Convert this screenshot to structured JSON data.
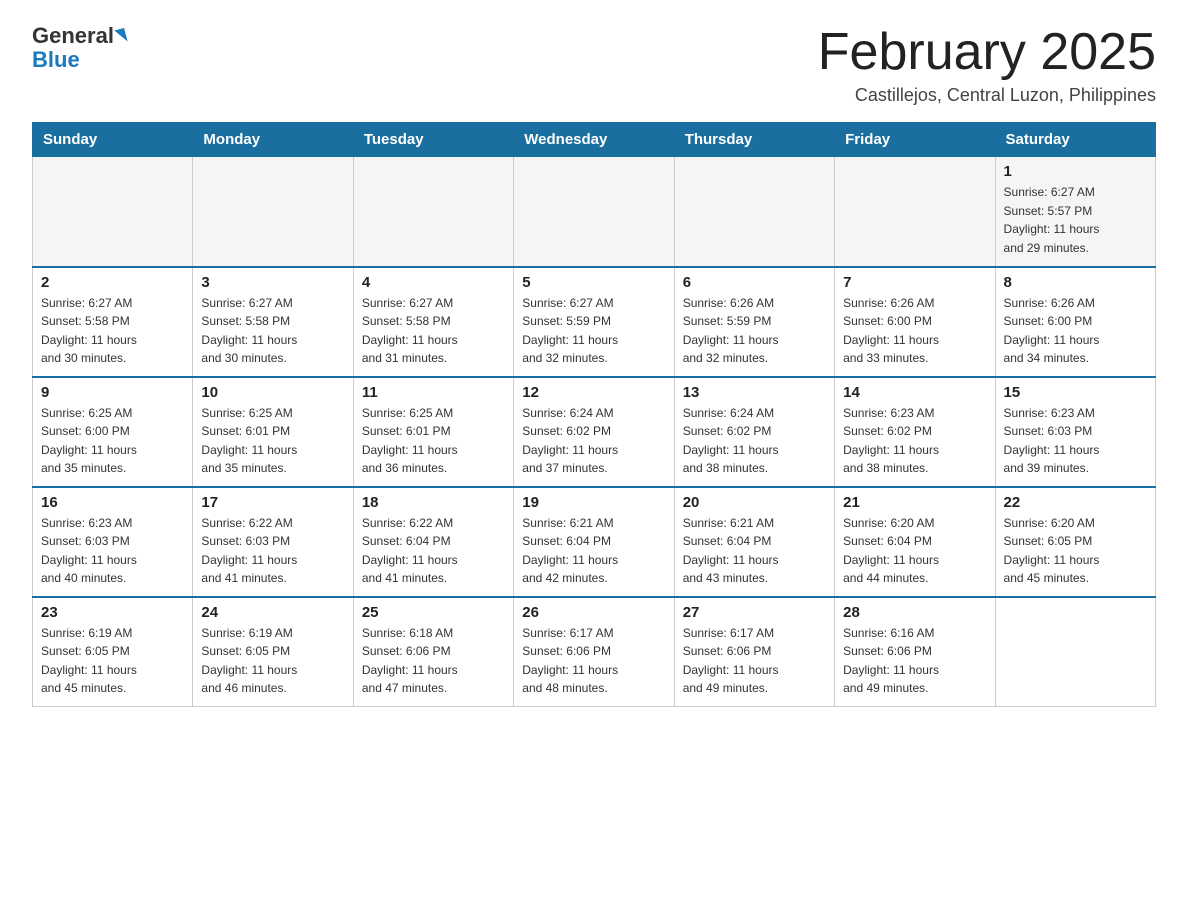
{
  "logo": {
    "general": "General",
    "blue": "Blue",
    "line1": "General"
  },
  "header": {
    "month_title": "February 2025",
    "location": "Castillejos, Central Luzon, Philippines"
  },
  "days_of_week": [
    "Sunday",
    "Monday",
    "Tuesday",
    "Wednesday",
    "Thursday",
    "Friday",
    "Saturday"
  ],
  "weeks": [
    [
      {
        "day": "",
        "info": ""
      },
      {
        "day": "",
        "info": ""
      },
      {
        "day": "",
        "info": ""
      },
      {
        "day": "",
        "info": ""
      },
      {
        "day": "",
        "info": ""
      },
      {
        "day": "",
        "info": ""
      },
      {
        "day": "1",
        "info": "Sunrise: 6:27 AM\nSunset: 5:57 PM\nDaylight: 11 hours\nand 29 minutes."
      }
    ],
    [
      {
        "day": "2",
        "info": "Sunrise: 6:27 AM\nSunset: 5:58 PM\nDaylight: 11 hours\nand 30 minutes."
      },
      {
        "day": "3",
        "info": "Sunrise: 6:27 AM\nSunset: 5:58 PM\nDaylight: 11 hours\nand 30 minutes."
      },
      {
        "day": "4",
        "info": "Sunrise: 6:27 AM\nSunset: 5:58 PM\nDaylight: 11 hours\nand 31 minutes."
      },
      {
        "day": "5",
        "info": "Sunrise: 6:27 AM\nSunset: 5:59 PM\nDaylight: 11 hours\nand 32 minutes."
      },
      {
        "day": "6",
        "info": "Sunrise: 6:26 AM\nSunset: 5:59 PM\nDaylight: 11 hours\nand 32 minutes."
      },
      {
        "day": "7",
        "info": "Sunrise: 6:26 AM\nSunset: 6:00 PM\nDaylight: 11 hours\nand 33 minutes."
      },
      {
        "day": "8",
        "info": "Sunrise: 6:26 AM\nSunset: 6:00 PM\nDaylight: 11 hours\nand 34 minutes."
      }
    ],
    [
      {
        "day": "9",
        "info": "Sunrise: 6:25 AM\nSunset: 6:00 PM\nDaylight: 11 hours\nand 35 minutes."
      },
      {
        "day": "10",
        "info": "Sunrise: 6:25 AM\nSunset: 6:01 PM\nDaylight: 11 hours\nand 35 minutes."
      },
      {
        "day": "11",
        "info": "Sunrise: 6:25 AM\nSunset: 6:01 PM\nDaylight: 11 hours\nand 36 minutes."
      },
      {
        "day": "12",
        "info": "Sunrise: 6:24 AM\nSunset: 6:02 PM\nDaylight: 11 hours\nand 37 minutes."
      },
      {
        "day": "13",
        "info": "Sunrise: 6:24 AM\nSunset: 6:02 PM\nDaylight: 11 hours\nand 38 minutes."
      },
      {
        "day": "14",
        "info": "Sunrise: 6:23 AM\nSunset: 6:02 PM\nDaylight: 11 hours\nand 38 minutes."
      },
      {
        "day": "15",
        "info": "Sunrise: 6:23 AM\nSunset: 6:03 PM\nDaylight: 11 hours\nand 39 minutes."
      }
    ],
    [
      {
        "day": "16",
        "info": "Sunrise: 6:23 AM\nSunset: 6:03 PM\nDaylight: 11 hours\nand 40 minutes."
      },
      {
        "day": "17",
        "info": "Sunrise: 6:22 AM\nSunset: 6:03 PM\nDaylight: 11 hours\nand 41 minutes."
      },
      {
        "day": "18",
        "info": "Sunrise: 6:22 AM\nSunset: 6:04 PM\nDaylight: 11 hours\nand 41 minutes."
      },
      {
        "day": "19",
        "info": "Sunrise: 6:21 AM\nSunset: 6:04 PM\nDaylight: 11 hours\nand 42 minutes."
      },
      {
        "day": "20",
        "info": "Sunrise: 6:21 AM\nSunset: 6:04 PM\nDaylight: 11 hours\nand 43 minutes."
      },
      {
        "day": "21",
        "info": "Sunrise: 6:20 AM\nSunset: 6:04 PM\nDaylight: 11 hours\nand 44 minutes."
      },
      {
        "day": "22",
        "info": "Sunrise: 6:20 AM\nSunset: 6:05 PM\nDaylight: 11 hours\nand 45 minutes."
      }
    ],
    [
      {
        "day": "23",
        "info": "Sunrise: 6:19 AM\nSunset: 6:05 PM\nDaylight: 11 hours\nand 45 minutes."
      },
      {
        "day": "24",
        "info": "Sunrise: 6:19 AM\nSunset: 6:05 PM\nDaylight: 11 hours\nand 46 minutes."
      },
      {
        "day": "25",
        "info": "Sunrise: 6:18 AM\nSunset: 6:06 PM\nDaylight: 11 hours\nand 47 minutes."
      },
      {
        "day": "26",
        "info": "Sunrise: 6:17 AM\nSunset: 6:06 PM\nDaylight: 11 hours\nand 48 minutes."
      },
      {
        "day": "27",
        "info": "Sunrise: 6:17 AM\nSunset: 6:06 PM\nDaylight: 11 hours\nand 49 minutes."
      },
      {
        "day": "28",
        "info": "Sunrise: 6:16 AM\nSunset: 6:06 PM\nDaylight: 11 hours\nand 49 minutes."
      },
      {
        "day": "",
        "info": ""
      }
    ]
  ]
}
